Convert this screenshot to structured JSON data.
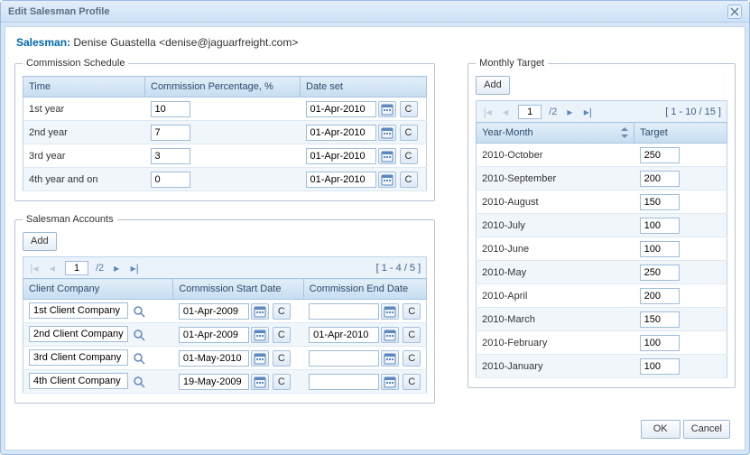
{
  "window": {
    "title": "Edit Salesman Profile"
  },
  "salesman": {
    "label": "Salesman:",
    "value": "Denise Guastella <denise@jaguarfreight.com>"
  },
  "commission_schedule": {
    "legend": "Commission Schedule",
    "headers": {
      "time": "Time",
      "pct": "Commission Percentage, %",
      "date": "Date set"
    },
    "rows": [
      {
        "time": "1st year",
        "pct": "10",
        "date": "01-Apr-2010"
      },
      {
        "time": "2nd year",
        "pct": "7",
        "date": "01-Apr-2010"
      },
      {
        "time": "3rd year",
        "pct": "3",
        "date": "01-Apr-2010"
      },
      {
        "time": "4th year and on",
        "pct": "0",
        "date": "01-Apr-2010"
      }
    ]
  },
  "accounts": {
    "legend": "Salesman Accounts",
    "add_label": "Add",
    "pager": {
      "page": "1",
      "of": "/2",
      "range": "[ 1 - 4 / 5 ]"
    },
    "headers": {
      "company": "Client Company",
      "start": "Commission Start Date",
      "end": "Commission End Date"
    },
    "rows": [
      {
        "company": "1st Client Company",
        "start": "01-Apr-2009",
        "end": ""
      },
      {
        "company": "2nd Client Company",
        "start": "01-Apr-2009",
        "end": "01-Apr-2010"
      },
      {
        "company": "3rd Client Company",
        "start": "01-May-2010",
        "end": ""
      },
      {
        "company": "4th Client Company",
        "start": "19-May-2009",
        "end": ""
      }
    ]
  },
  "targets": {
    "legend": "Monthly Target",
    "add_label": "Add",
    "pager": {
      "page": "1",
      "of": "/2",
      "range": "[ 1 - 10 / 15 ]"
    },
    "headers": {
      "ym": "Year-Month",
      "target": "Target"
    },
    "rows": [
      {
        "ym": "2010-October",
        "target": "250"
      },
      {
        "ym": "2010-September",
        "target": "200"
      },
      {
        "ym": "2010-August",
        "target": "150"
      },
      {
        "ym": "2010-July",
        "target": "100"
      },
      {
        "ym": "2010-June",
        "target": "100"
      },
      {
        "ym": "2010-May",
        "target": "250"
      },
      {
        "ym": "2010-April",
        "target": "200"
      },
      {
        "ym": "2010-March",
        "target": "150"
      },
      {
        "ym": "2010-February",
        "target": "100"
      },
      {
        "ym": "2010-January",
        "target": "100"
      }
    ]
  },
  "footer": {
    "ok": "OK",
    "cancel": "Cancel"
  },
  "clear_label": "C"
}
